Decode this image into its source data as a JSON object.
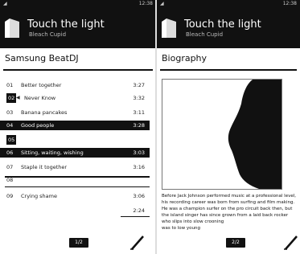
{
  "left": {
    "status": {
      "time": "12:38"
    },
    "header": {
      "title": "Touch the light",
      "subtitle": "Bleach Cupid"
    },
    "section_title": "Samsung BeatDJ",
    "tracks": [
      {
        "num": "01",
        "title": "Better together",
        "dur": "3:27"
      },
      {
        "num": "02",
        "title": "Never Know",
        "dur": "3:32"
      },
      {
        "num": "03",
        "title": "Banana pancakes",
        "dur": "3:11"
      },
      {
        "num": "04",
        "title": "Good people",
        "dur": "3:28"
      },
      {
        "num": "05",
        "title": "",
        "dur": ""
      },
      {
        "num": "06",
        "title": "Sitting, waiting, wishing",
        "dur": "3:03"
      },
      {
        "num": "07",
        "title": "Staple it together",
        "dur": "3:16"
      },
      {
        "num": "08",
        "title": "",
        "dur": ""
      },
      {
        "num": "09",
        "title": "Crying shame",
        "dur": "3:06"
      },
      {
        "num": "",
        "title": "",
        "dur": "2:24"
      }
    ],
    "pager": "1/2"
  },
  "right": {
    "status": {
      "time": "12:38"
    },
    "header": {
      "title": "Touch the light",
      "subtitle": "Bleach Cupid"
    },
    "section_title": "Biography",
    "bio_text": "Before Jack Johnson performed music at a professional level, his recording career was born from surfing and film making. He was a champion surfer on the pro circuit back then, but the island singer has since grown from a laid back rocker who slips into slow crooning",
    "bio_tail": "was to low young",
    "pager": "2/2"
  },
  "colors": {
    "bar": "#111111",
    "selected": "#111111"
  }
}
